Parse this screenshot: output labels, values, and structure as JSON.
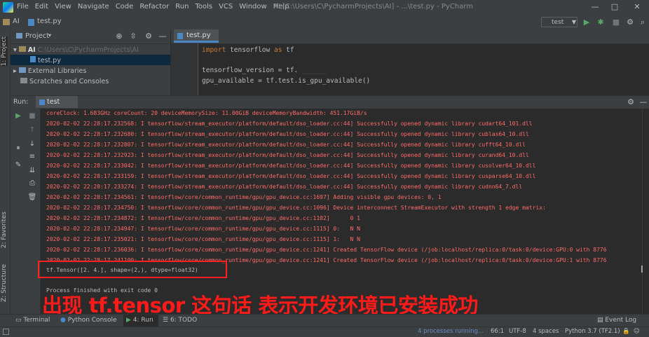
{
  "titlebar": {
    "menus": [
      "File",
      "Edit",
      "View",
      "Navigate",
      "Code",
      "Refactor",
      "Run",
      "Tools",
      "VCS",
      "Window",
      "Help"
    ],
    "window_title": "AI [C:\\Users\\C\\PycharmProjects\\AI] - ...\\test.py - PyCharm",
    "minimize": "—",
    "maximize": "□",
    "close": "✕"
  },
  "navbar": {
    "project": "AI",
    "file": "test.py",
    "run_config": "test"
  },
  "left_stripe": {
    "project": "1: Project",
    "favorites": "2: Favorites",
    "structure": "Z: Structure"
  },
  "project_panel": {
    "title": "Project",
    "tree": [
      {
        "label": "AI",
        "detail": "C:\\Users\\C\\PycharmProjects\\AI"
      },
      {
        "label": "test.py"
      },
      {
        "label": "External Libraries"
      },
      {
        "label": "Scratches and Consoles"
      }
    ]
  },
  "editor": {
    "tab": "test.py",
    "lines": [
      {
        "kw": "import",
        "rest": " tensorflow ",
        "kw2": "as",
        "rest2": " tf"
      },
      {
        "kw": "",
        "rest": "",
        "kw2": "",
        "rest2": ""
      },
      {
        "kw": "",
        "rest": "tensorflow_version = tf.",
        "kw2": "",
        "rest2": ""
      },
      {
        "kw": "",
        "rest": "gpu_available = tf.test.is_gpu_available()",
        "kw2": "",
        "rest2": ""
      }
    ]
  },
  "run_panel": {
    "label": "Run:",
    "tab": "test"
  },
  "console": {
    "lines": [
      {
        "cls": "err",
        "text": "coreClock: 1.683GHz coreCount: 20 deviceMemorySize: 11.00GiB deviceMemoryBandwidth: 451.17GiB/s"
      },
      {
        "cls": "err",
        "text": "2020-02-02 22:28:17.232568: I tensorflow/stream_executor/platform/default/dso_loader.cc:44] Successfully opened dynamic library cudart64_101.dll"
      },
      {
        "cls": "err",
        "text": "2020-02-02 22:28:17.232680: I tensorflow/stream_executor/platform/default/dso_loader.cc:44] Successfully opened dynamic library cublas64_10.dll"
      },
      {
        "cls": "err",
        "text": "2020-02-02 22:28:17.232807: I tensorflow/stream_executor/platform/default/dso_loader.cc:44] Successfully opened dynamic library cufft64_10.dll"
      },
      {
        "cls": "err",
        "text": "2020-02-02 22:28:17.232923: I tensorflow/stream_executor/platform/default/dso_loader.cc:44] Successfully opened dynamic library curand64_10.dll"
      },
      {
        "cls": "err",
        "text": "2020-02-02 22:28:17.233042: I tensorflow/stream_executor/platform/default/dso_loader.cc:44] Successfully opened dynamic library cusolver64_10.dll"
      },
      {
        "cls": "err",
        "text": "2020-02-02 22:28:17.233159: I tensorflow/stream_executor/platform/default/dso_loader.cc:44] Successfully opened dynamic library cusparse64_10.dll"
      },
      {
        "cls": "err",
        "text": "2020-02-02 22:28:17.233274: I tensorflow/stream_executor/platform/default/dso_loader.cc:44] Successfully opened dynamic library cudnn64_7.dll"
      },
      {
        "cls": "err",
        "text": "2020-02-02 22:28:17.234561: I tensorflow/core/common_runtime/gpu/gpu_device.cc:1697] Adding visible gpu devices: 0, 1"
      },
      {
        "cls": "err",
        "text": "2020-02-02 22:28:17.234750: I tensorflow/core/common_runtime/gpu/gpu_device.cc:1096] Device interconnect StreamExecutor with strength 1 edge matrix:"
      },
      {
        "cls": "err",
        "text": "2020-02-02 22:28:17.234872: I tensorflow/core/common_runtime/gpu/gpu_device.cc:1102]      0 1"
      },
      {
        "cls": "err",
        "text": "2020-02-02 22:28:17.234947: I tensorflow/core/common_runtime/gpu/gpu_device.cc:1115] 0:   N N"
      },
      {
        "cls": "err",
        "text": "2020-02-02 22:28:17.235021: I tensorflow/core/common_runtime/gpu/gpu_device.cc:1115] 1:   N N"
      },
      {
        "cls": "err",
        "text": "2020-02-02 22:28:17.236036: I tensorflow/core/common_runtime/gpu/gpu_device.cc:1241] Created TensorFlow device (/job:localhost/replica:0/task:0/device:GPU:0 with 8776"
      },
      {
        "cls": "err",
        "text": "2020-02-02 22:28:17.241100: I tensorflow/core/common_runtime/gpu/gpu_device.cc:1241] Created TensorFlow device (/job:localhost/replica:0/task:0/device:GPU:1 with 8776"
      },
      {
        "cls": "norm",
        "text": "tf.Tensor([2. 4.], shape=(2,), dtype=float32)"
      },
      {
        "cls": "norm",
        "text": ""
      },
      {
        "cls": "norm",
        "text": "Process finished with exit code 0"
      }
    ]
  },
  "annotation": "出现 tf.tensor 这句话 表示开发环境已安装成功",
  "bottom_tabs": {
    "terminal": "Terminal",
    "python_console": "Python Console",
    "run": "4: Run",
    "todo": "6: TODO",
    "event_log": "Event Log"
  },
  "statusbar": {
    "processes": "4 processes running...",
    "position": "66:1",
    "encoding": "UTF-8",
    "indent": "4 spaces",
    "interpreter": "Python 3.7 (TF2.1)"
  },
  "colors": {
    "error_text": "#ff6b68",
    "annotation": "#ff1a1a",
    "keyword": "#cc7832"
  }
}
